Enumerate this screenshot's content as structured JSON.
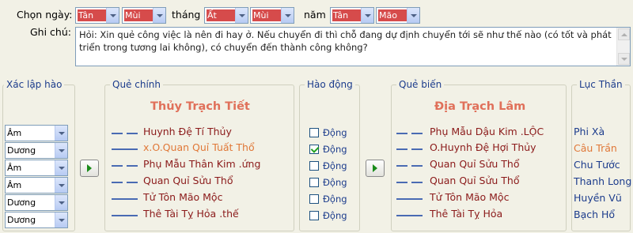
{
  "header": {
    "date_label": "Chọn ngày:",
    "month_label": "tháng",
    "year_label": "năm",
    "day_can": "Tân",
    "day_chi": "Mùi",
    "month_can": "Ất",
    "month_chi": "Mùi",
    "year_can": "Tân",
    "year_chi": "Mão"
  },
  "note": {
    "label": "Ghi chú:",
    "text": "Hỏi: Xin quẻ công việc là nên đi hay ở. Nếu chuyển đi thì chỗ đang dự định chuyển tới sẽ như thế nào (có tốt và phát triển trong tương lai không), có chuyển đến thành công không?"
  },
  "sections": {
    "setup": "Xác lập hào",
    "main": "Quẻ chính",
    "moving": "Hào động",
    "changed": "Quẻ biến",
    "spirits": "Lục Thần"
  },
  "setup_values": [
    "Âm",
    "Dương",
    "Âm",
    "Âm",
    "Dương",
    "Dương"
  ],
  "main_hexagram": {
    "name": "Thủy Trạch Tiết",
    "lines": [
      "Huynh Đệ Tí Thủy",
      "x.O.Quan Quỉ Tuất Thổ",
      "Phụ Mẫu Thân Kim .ứng",
      "Quan Quỉ Sửu Thổ",
      "Tử Tôn Mão Mộc",
      "Thê Tài Tỵ Hỏa .thế"
    ]
  },
  "moving_lines": {
    "label": "Động",
    "checked": [
      false,
      true,
      false,
      false,
      false,
      false
    ]
  },
  "changed_hexagram": {
    "name": "Địa Trạch Lâm",
    "lines": [
      "Phụ Mẫu Dậu Kim .LỘC",
      "O.Huynh Đệ Hợi Thủy",
      "Quan Quỉ Sửu Thổ",
      "Quan Quỉ Sửu Thổ",
      "Tử Tôn Mão Mộc",
      "Thê Tài Tỵ Hỏa"
    ]
  },
  "six_spirits": [
    "Phi Xà",
    "Câu Trần",
    "Chu Tước",
    "Thanh Long",
    "Huyền Vũ",
    "Bạch Hổ"
  ],
  "colors": {
    "line_text": "#8b1a1a",
    "changing_line": "#e07838",
    "hexagram_name": "#e0705a",
    "label_blue": "#1c3c8c",
    "bar_blue": "#4a6bb3",
    "date_highlight": "#d64b4b"
  }
}
